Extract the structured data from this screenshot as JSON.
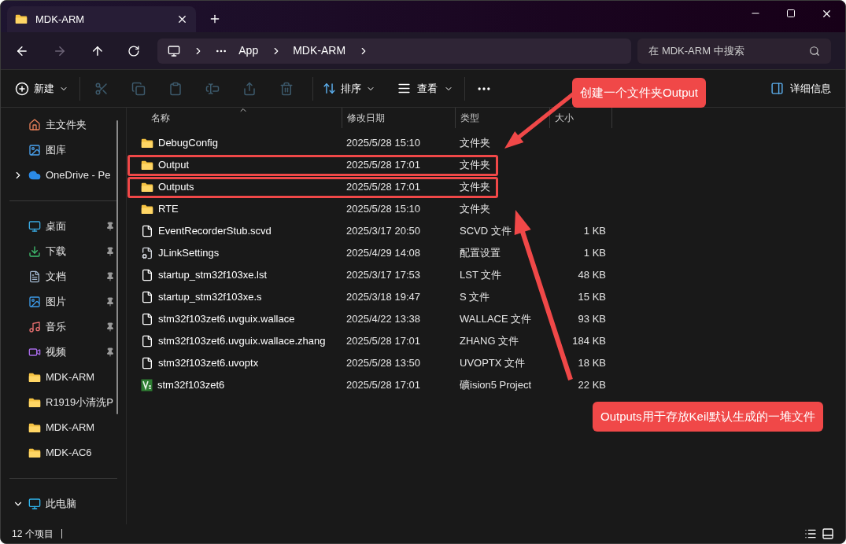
{
  "window": {
    "tab_title": "MDK-ARM"
  },
  "address": {
    "crumbs": [
      "App",
      "MDK-ARM"
    ]
  },
  "search": {
    "placeholder": "在 MDK-ARM 中搜索"
  },
  "toolbar": {
    "new_label": "新建",
    "sort_label": "排序",
    "view_label": "查看",
    "details_label": "详细信息",
    "actions": [
      {
        "kind": "cut",
        "disabled": true
      },
      {
        "kind": "copy",
        "disabled": true
      },
      {
        "kind": "paste",
        "disabled": true
      },
      {
        "kind": "rename",
        "disabled": true
      },
      {
        "kind": "share",
        "disabled": true
      },
      {
        "kind": "delete",
        "disabled": true
      }
    ]
  },
  "sidebar": {
    "groups": [
      [
        {
          "label": "主文件夹",
          "kind": "home",
          "pinned": false
        },
        {
          "label": "图库",
          "kind": "gallery",
          "pinned": false
        },
        {
          "label": "OneDrive - Pe",
          "kind": "cloud",
          "pinned": false,
          "expanded": false
        }
      ],
      [
        {
          "label": "桌面",
          "kind": "desktop",
          "pinned": true
        },
        {
          "label": "下载",
          "kind": "download",
          "pinned": true
        },
        {
          "label": "文档",
          "kind": "documents",
          "pinned": true
        },
        {
          "label": "图片",
          "kind": "pictures",
          "pinned": true
        },
        {
          "label": "音乐",
          "kind": "music",
          "pinned": true
        },
        {
          "label": "视频",
          "kind": "videos",
          "pinned": true
        },
        {
          "label": "MDK-ARM",
          "kind": "folder",
          "pinned": false
        },
        {
          "label": "R1919小清洗P",
          "kind": "folder",
          "pinned": false
        },
        {
          "label": "MDK-ARM",
          "kind": "folder",
          "pinned": false
        },
        {
          "label": "MDK-AC6",
          "kind": "folder",
          "pinned": false
        }
      ],
      [
        {
          "label": "此电脑",
          "kind": "pc",
          "pinned": false,
          "expanded": true
        }
      ]
    ]
  },
  "table": {
    "columns": [
      "名称",
      "修改日期",
      "类型",
      "大小"
    ],
    "rows": [
      {
        "name": "DebugConfig",
        "date": "2025/5/28 15:10",
        "type": "文件夹",
        "kind": "folder",
        "highlighted": false
      },
      {
        "name": "Output",
        "date": "2025/5/28 17:01",
        "type": "文件夹",
        "kind": "folder",
        "highlighted": true
      },
      {
        "name": "Outputs",
        "date": "2025/5/28 17:01",
        "type": "文件夹",
        "kind": "folder",
        "highlighted": true
      },
      {
        "name": "RTE",
        "date": "2025/5/28 15:10",
        "type": "文件夹",
        "kind": "folder",
        "highlighted": false
      },
      {
        "name": "EventRecorderStub.scvd",
        "date": "2025/3/17 20:50",
        "type": "SCVD 文件",
        "size": "1 KB",
        "kind": "file",
        "highlighted": false
      },
      {
        "name": "JLinkSettings",
        "date": "2025/4/29 14:08",
        "type": "配置设置",
        "size": "1 KB",
        "kind": "settings",
        "highlighted": false
      },
      {
        "name": "startup_stm32f103xe.lst",
        "date": "2025/3/17 17:53",
        "type": "LST 文件",
        "size": "48 KB",
        "kind": "file",
        "highlighted": false
      },
      {
        "name": "startup_stm32f103xe.s",
        "date": "2025/3/18 19:47",
        "type": "S 文件",
        "size": "15 KB",
        "kind": "file",
        "highlighted": false
      },
      {
        "name": "stm32f103zet6.uvguix.wallace",
        "date": "2025/4/22 13:38",
        "type": "WALLACE 文件",
        "size": "93 KB",
        "kind": "file",
        "highlighted": false
      },
      {
        "name": "stm32f103zet6.uvguix.wallace.zhang",
        "date": "2025/5/28 17:01",
        "type": "ZHANG 文件",
        "size": "184 KB",
        "kind": "file",
        "highlighted": false
      },
      {
        "name": "stm32f103zet6.uvoptx",
        "date": "2025/5/28 13:50",
        "type": "UVOPTX 文件",
        "size": "18 KB",
        "kind": "file",
        "highlighted": false
      },
      {
        "name": "stm32f103zet6",
        "date": "2025/5/28 17:01",
        "type": "礦ision5 Project",
        "size": "22 KB",
        "kind": "keil",
        "highlighted": false
      }
    ]
  },
  "callouts": [
    {
      "text": "创建一个文件夹Output"
    },
    {
      "text": "Outputs用于存放Keil默认生成的一堆文件"
    }
  ],
  "status_bar": {
    "count": "12 个项目"
  }
}
